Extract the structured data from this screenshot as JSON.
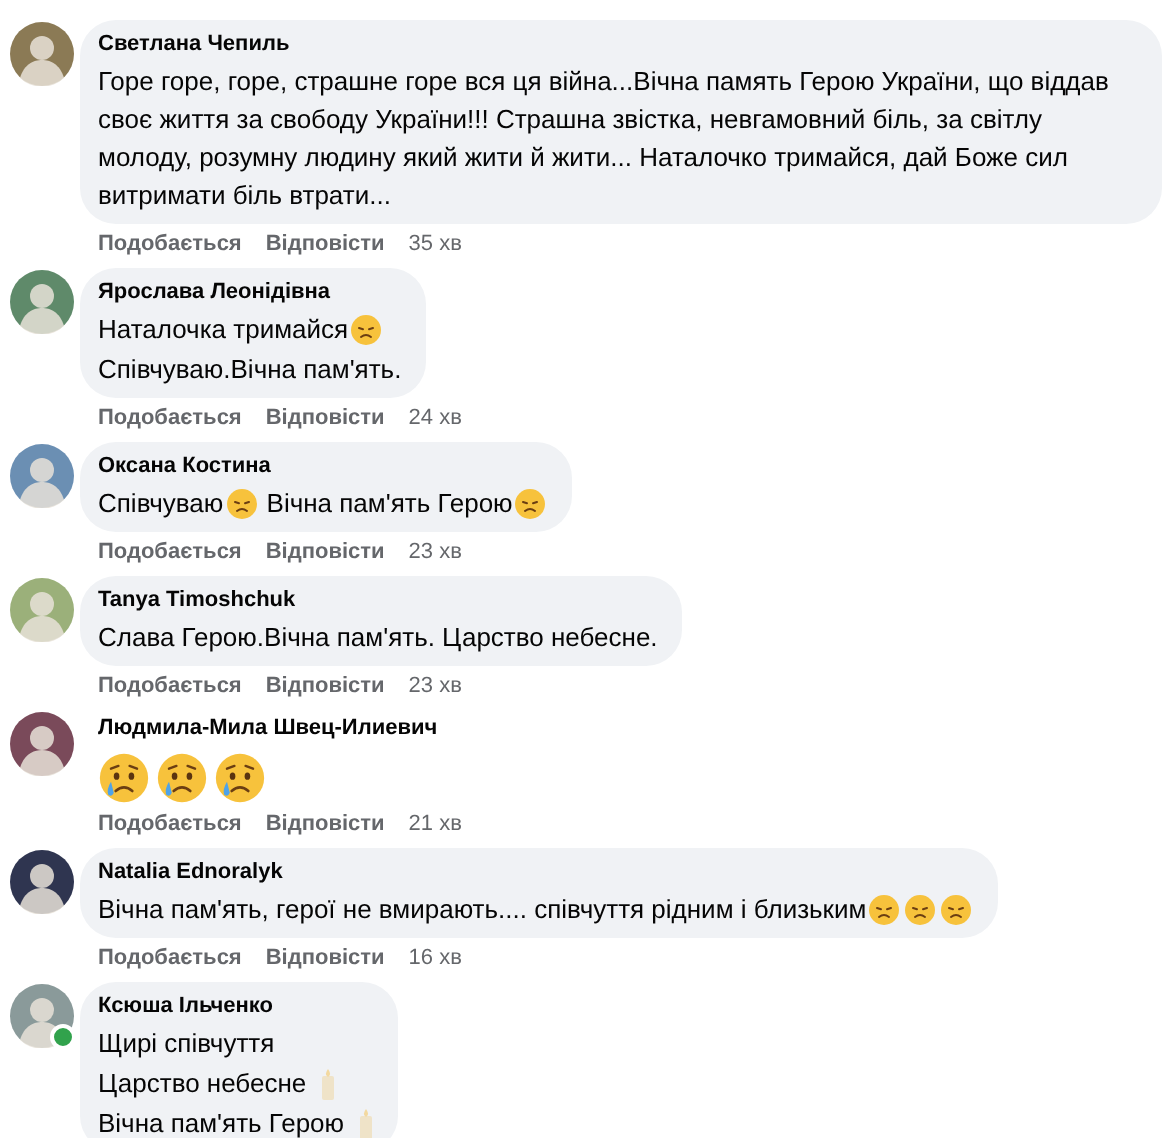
{
  "comments": [
    {
      "kind": "bubble",
      "author": "Светлана Чепиль",
      "online": false,
      "lines": [
        [
          {
            "kind": "text",
            "text": "Горе горе, горе, страшне горе вся ця війна...Вічна память Герою України, що віддав своє життя за свободу України!!! Страшна звістка, невгамовний біль, за світлу молоду, розумну людину який жити й жити... Наталочко тримайся, дай Боже сил витримати біль втрати..."
          }
        ]
      ],
      "actions": {
        "like": "Подобається",
        "reply": "Відповісти",
        "time": "35 хв"
      }
    },
    {
      "kind": "bubble",
      "author": "Ярослава Леонідівна",
      "online": false,
      "lines": [
        [
          {
            "kind": "text",
            "text": "Наталочка тримайся"
          },
          {
            "kind": "sad"
          }
        ],
        [
          {
            "kind": "text",
            "text": "Співчуваю.Вічна пам'ять."
          }
        ]
      ],
      "actions": {
        "like": "Подобається",
        "reply": "Відповісти",
        "time": "24 хв"
      }
    },
    {
      "kind": "bubble",
      "author": "Оксана Костина",
      "online": false,
      "lines": [
        [
          {
            "kind": "text",
            "text": "Співчуваю"
          },
          {
            "kind": "sad"
          },
          {
            "kind": "text",
            "text": " Вічна пам'ять Герою"
          },
          {
            "kind": "sad"
          }
        ]
      ],
      "actions": {
        "like": "Подобається",
        "reply": "Відповісти",
        "time": "23 хв"
      }
    },
    {
      "kind": "bubble",
      "author": "Tanya Timoshchuk",
      "online": false,
      "lines": [
        [
          {
            "kind": "text",
            "text": "Слава Герою.Вічна пам'ять. Царство небесне."
          }
        ]
      ],
      "actions": {
        "like": "Подобається",
        "reply": "Відповісти",
        "time": "23 хв"
      }
    },
    {
      "kind": "plain",
      "author": "Людмила-Мила Швец-Илиевич",
      "online": false,
      "lines": [
        [
          {
            "kind": "crying-large"
          },
          {
            "kind": "crying-large"
          },
          {
            "kind": "crying-large"
          }
        ]
      ],
      "actions": {
        "like": "Подобається",
        "reply": "Відповісти",
        "time": "21 хв"
      }
    },
    {
      "kind": "bubble",
      "author": "Natalia Ednoralyk",
      "online": false,
      "lines": [
        [
          {
            "kind": "text",
            "text": "Вічна пам'ять, герої не вмирають.... співчуття рідним і близьким"
          },
          {
            "kind": "sad"
          },
          {
            "kind": "sad"
          },
          {
            "kind": "sad"
          }
        ]
      ],
      "actions": {
        "like": "Подобається",
        "reply": "Відповісти",
        "time": "16 хв"
      }
    },
    {
      "kind": "bubble",
      "author": "Ксюша Ільченко",
      "online": true,
      "lines": [
        [
          {
            "kind": "text",
            "text": "Щирі співчуття"
          }
        ],
        [
          {
            "kind": "text",
            "text": "Царство небесне "
          },
          {
            "kind": "candle"
          }
        ],
        [
          {
            "kind": "text",
            "text": "Вічна пам'ять Герою "
          },
          {
            "kind": "candle"
          }
        ]
      ]
    }
  ]
}
